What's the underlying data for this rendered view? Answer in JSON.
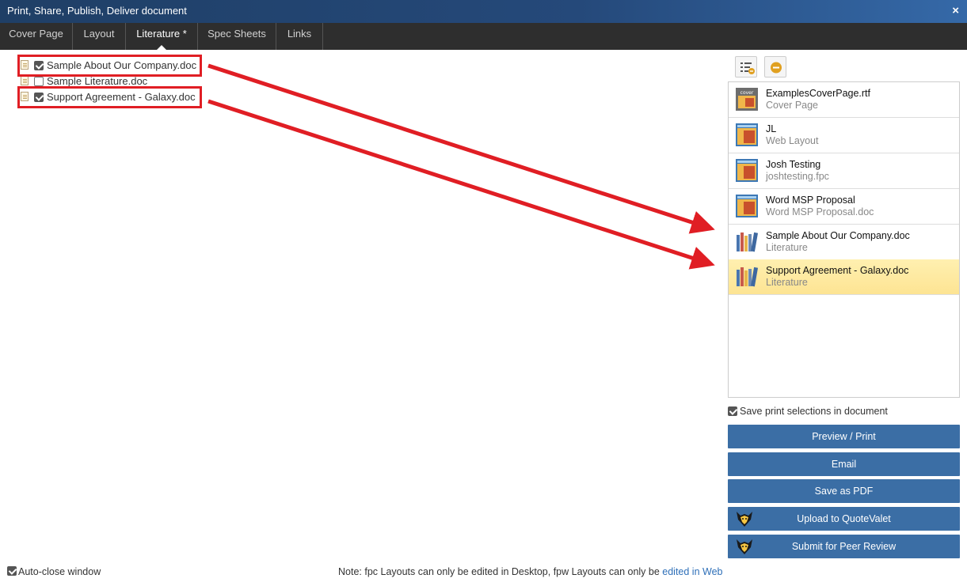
{
  "window": {
    "title": "Print, Share, Publish, Deliver document",
    "close_label": "×"
  },
  "tabs": [
    {
      "label": "Cover Page"
    },
    {
      "label": "Layout"
    },
    {
      "label": "Literature *"
    },
    {
      "label": "Spec Sheets"
    },
    {
      "label": "Links"
    }
  ],
  "active_tab": "Literature *",
  "documents": [
    {
      "name": "Sample About Our Company.doc",
      "checked": true
    },
    {
      "name": "Sample Literature.doc",
      "checked": false
    },
    {
      "name": "Support Agreement - Galaxy.doc",
      "checked": true
    }
  ],
  "selection_list": [
    {
      "title": "ExamplesCoverPage.rtf",
      "subtitle": "Cover Page",
      "icon": "cover-page-icon"
    },
    {
      "title": "JL",
      "subtitle": "Web Layout",
      "icon": "layout-icon"
    },
    {
      "title": "Josh Testing",
      "subtitle": "joshtesting.fpc",
      "icon": "layout-icon"
    },
    {
      "title": "Word MSP Proposal",
      "subtitle": "Word MSP Proposal.doc",
      "icon": "layout-icon"
    },
    {
      "title": "Sample About Our Company.doc",
      "subtitle": "Literature",
      "icon": "literature-icon"
    },
    {
      "title": "Support Agreement - Galaxy.doc",
      "subtitle": "Literature",
      "icon": "literature-icon",
      "selected": true
    }
  ],
  "save_selections": {
    "label": "Save print selections in document",
    "checked": true
  },
  "actions": {
    "preview_print": "Preview / Print",
    "email": "Email",
    "save_pdf": "Save as PDF",
    "upload_quotevalet": "Upload to QuoteValet",
    "submit_peer_review": "Submit for Peer Review"
  },
  "auto_close": {
    "label": "Auto-close window",
    "checked": true
  },
  "note": {
    "text": "Note: fpc Layouts can only be edited in Desktop, fpw Layouts can only be ",
    "link": "edited in Web"
  },
  "colors": {
    "accent": "#3b6ea5",
    "highlight": "#e01e24",
    "selected_row": "#fde493",
    "tabbar": "#2e2e2e"
  }
}
